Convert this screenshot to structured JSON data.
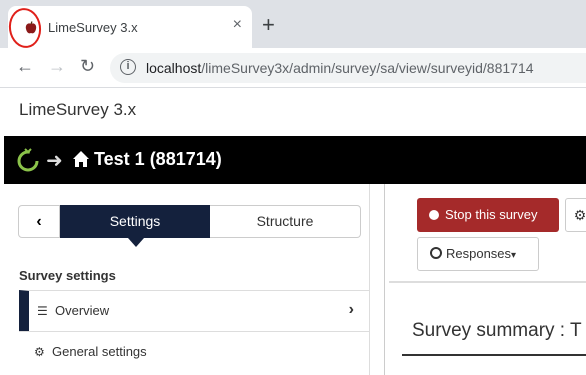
{
  "browser": {
    "tab_title": "LimeSurvey 3.x",
    "close_glyph": "×",
    "new_tab_glyph": "+",
    "back_glyph": "←",
    "forward_glyph": "→",
    "reload_glyph": "↻",
    "url_host": "localhost",
    "url_path": "/limeSurvey3x/admin/survey/sa/view/surveyid/881714",
    "info_glyph": "i"
  },
  "app": {
    "brand": "LimeSurvey 3.x",
    "survey_title": "Test 1 (881714)",
    "arrow_glyph": "➜"
  },
  "sidebar": {
    "collapse_glyph": "‹",
    "tabs": [
      {
        "label": "Settings",
        "active": true
      },
      {
        "label": "Structure",
        "active": false
      }
    ],
    "section_title": "Survey settings",
    "items": [
      {
        "label": "Overview",
        "icon": "list-icon",
        "glyph": "☰",
        "active": true,
        "chevron": "›"
      },
      {
        "label": "General settings",
        "icon": "gears-icon",
        "glyph": "⚙",
        "active": false
      }
    ]
  },
  "main": {
    "stop_button": "Stop this survey",
    "gear_glyph": "⚙",
    "responses_button": "Responses",
    "caret_glyph": "▾",
    "summary_title": "Survey summary : T"
  },
  "colors": {
    "navy": "#14213d",
    "stop_red": "#a52a2a",
    "lime_green": "#8bc34a",
    "annotation_red": "#e0201a"
  }
}
